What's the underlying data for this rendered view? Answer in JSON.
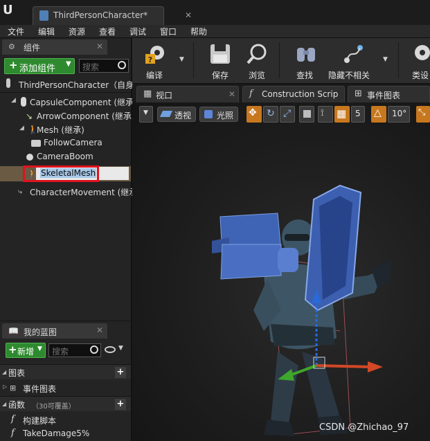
{
  "window": {
    "doc_tab_label": "ThirdPersonCharacter*",
    "doc_tab_close": "✕"
  },
  "menu": [
    "文件",
    "编辑",
    "资源",
    "查看",
    "调试",
    "窗口",
    "帮助"
  ],
  "components_panel": {
    "tab_label": "组件",
    "tab_close": "✕",
    "add_button_label": "添加组件",
    "search_placeholder": "搜索",
    "root_item": "ThirdPersonCharacter（自身",
    "items": [
      "CapsuleComponent (继承)",
      "ArrowComponent (继承)",
      "Mesh (继承)",
      "FollowCamera",
      "CameraBoom",
      "SkeletalMesh",
      "CharacterMovement (继承)"
    ]
  },
  "blueprint_panel": {
    "tab_label": "我的蓝图",
    "tab_close": "✕",
    "new_button_label": "新增",
    "search_placeholder": "搜索",
    "graphs_section": "图表",
    "event_graph_item": "事件图表",
    "functions_section": "函数",
    "functions_note": "（30可覆盖）",
    "functions": [
      "构建脚本",
      "TakeDamage5%"
    ]
  },
  "toolbar": {
    "buttons": [
      "编译",
      "保存",
      "浏览",
      "查找",
      "隐藏不相关",
      "类设"
    ]
  },
  "editor_tabs": {
    "viewport": "视口",
    "construction_script": "Construction Scrip",
    "event_graph": "事件图表",
    "close": "✕"
  },
  "viewport": {
    "perspective_label": "透视",
    "lit_label": "光照",
    "grid_snap_value": "5",
    "rotation_snap_value": "10°"
  },
  "watermark": "CSDN @Zhichao_97",
  "colors": {
    "add_button": "#2e8a2e",
    "selection_row": "#6a5a43",
    "highlight_box": "#e0121d",
    "snap_orange": "#c7781f",
    "mesh_blue": "#3f63b5"
  }
}
